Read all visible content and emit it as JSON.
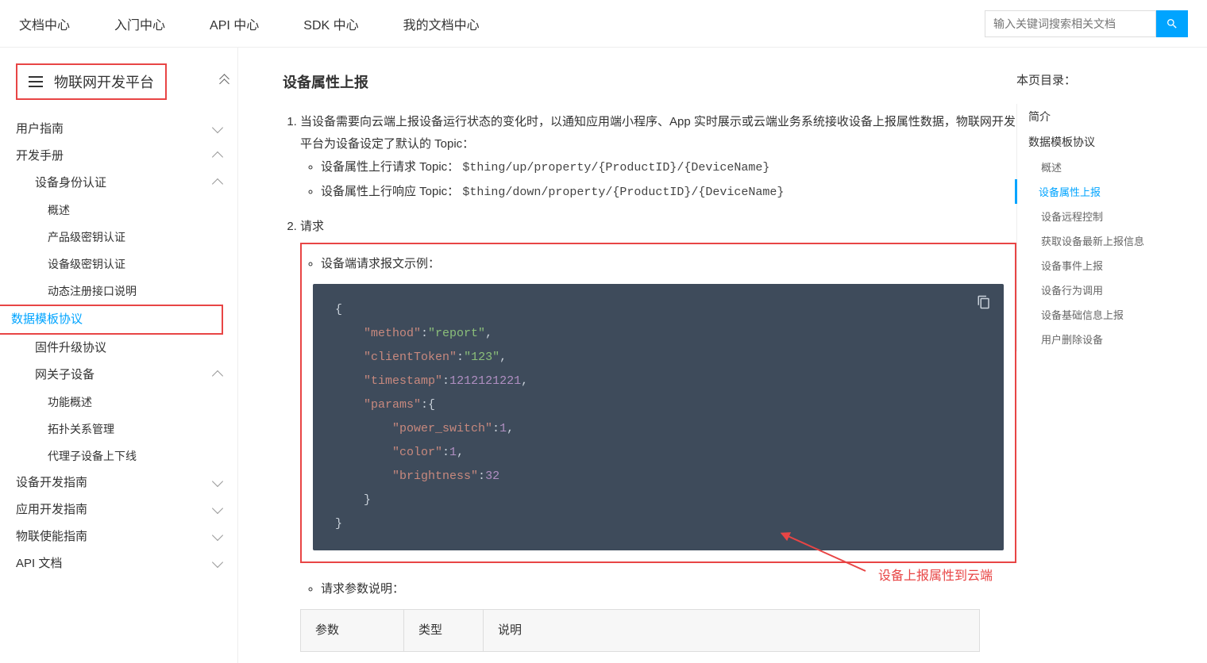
{
  "topnav": {
    "items": [
      "文档中心",
      "入门中心",
      "API 中心",
      "SDK 中心",
      "我的文档中心"
    ],
    "search_placeholder": "输入关键词搜索相关文档"
  },
  "sidebar": {
    "product": "物联网开发平台",
    "groups": [
      {
        "label": "用户指南",
        "expanded": false,
        "children": []
      },
      {
        "label": "开发手册",
        "expanded": true,
        "children": [
          {
            "label": "设备身份认证",
            "expanded": true,
            "children": [
              {
                "label": "概述"
              },
              {
                "label": "产品级密钥认证"
              },
              {
                "label": "设备级密钥认证"
              },
              {
                "label": "动态注册接口说明"
              }
            ]
          },
          {
            "label": "数据模板协议",
            "active": true
          },
          {
            "label": "固件升级协议"
          },
          {
            "label": "网关子设备",
            "expanded": true,
            "children": [
              {
                "label": "功能概述"
              },
              {
                "label": "拓扑关系管理"
              },
              {
                "label": "代理子设备上下线"
              }
            ]
          }
        ]
      },
      {
        "label": "设备开发指南",
        "expanded": false,
        "children": []
      },
      {
        "label": "应用开发指南",
        "expanded": false,
        "children": []
      },
      {
        "label": "物联使能指南",
        "expanded": false,
        "children": []
      },
      {
        "label": "API 文档",
        "expanded": false,
        "children": []
      }
    ]
  },
  "content": {
    "heading": "设备属性上报",
    "list1_intro": "当设备需要向云端上报设备运行状态的变化时，以通知应用端小程序、App 实时展示或云端业务系统接收设备上报属性数据，物联网开发平台为设备设定了默认的 Topic：",
    "topics": [
      {
        "label": "设备属性上行请求 Topic：",
        "value": "$thing/up/property/{ProductID}/{DeviceName}"
      },
      {
        "label": "设备属性上行响应 Topic：",
        "value": "$thing/down/property/{ProductID}/{DeviceName}"
      }
    ],
    "list2_label": "请求",
    "code_caption": "设备端请求报文示例：",
    "code_json": {
      "method": "report",
      "clientToken": "123",
      "timestamp": 1212121221,
      "params": {
        "power_switch": 1,
        "color": 1,
        "brightness": 32
      }
    },
    "param_caption": "请求参数说明：",
    "param_headers": [
      "参数",
      "类型",
      "说明"
    ],
    "annotation": "设备上报属性到云端"
  },
  "toc": {
    "title": "本页目录：",
    "items": [
      {
        "label": "简介",
        "level": "a"
      },
      {
        "label": "数据模板协议",
        "level": "a"
      },
      {
        "label": "概述",
        "level": "b"
      },
      {
        "label": "设备属性上报",
        "level": "b",
        "active": true
      },
      {
        "label": "设备远程控制",
        "level": "b"
      },
      {
        "label": "获取设备最新上报信息",
        "level": "b"
      },
      {
        "label": "设备事件上报",
        "level": "b"
      },
      {
        "label": "设备行为调用",
        "level": "b"
      },
      {
        "label": "设备基础信息上报",
        "level": "b"
      },
      {
        "label": "用户删除设备",
        "level": "b"
      }
    ]
  }
}
